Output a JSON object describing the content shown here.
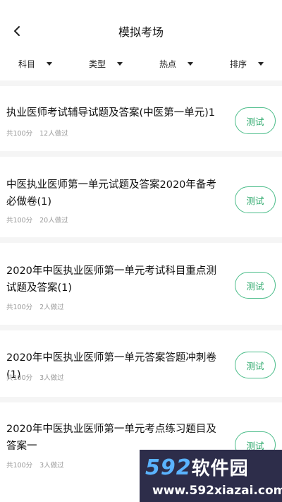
{
  "header": {
    "title": "模拟考场"
  },
  "filters": [
    {
      "label": "科目"
    },
    {
      "label": "类型"
    },
    {
      "label": "热点"
    },
    {
      "label": "排序"
    }
  ],
  "items": [
    {
      "title": "执业医师考试辅导试题及答案(中医第一单元)1",
      "score": "共100分",
      "done": "12人做过",
      "button": "测试"
    },
    {
      "title": "中医执业医师第一单元试题及答案2020年备考必做卷(1)",
      "score": "共100分",
      "done": "20人做过",
      "button": "测试"
    },
    {
      "title": "2020年中医执业医师第一单元考试科目重点测试题及答案(1)",
      "score": "共100分",
      "done": "2人做过",
      "button": "测试"
    },
    {
      "title": "2020年中医执业医师第一单元答案答题冲刺卷(1)",
      "score": "共100分",
      "done": "3人做过",
      "button": "测试"
    },
    {
      "title": "2020年中医执业医师第一单元考点练习题目及答案一",
      "score": "共100分",
      "done": "3人做过",
      "button": "测试"
    }
  ],
  "watermark": {
    "brand_num": "592",
    "brand_cn": "软件园",
    "url": "www.592xiazai.com"
  }
}
